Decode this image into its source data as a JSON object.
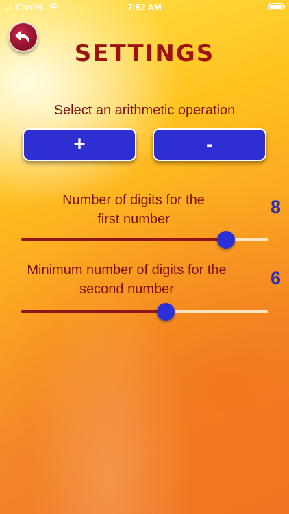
{
  "status_bar": {
    "carrier": "Carrier",
    "time": "7:52 AM"
  },
  "header": {
    "title": "SETTINGS",
    "back_icon": "back-arrow-icon"
  },
  "operation": {
    "label": "Select an arithmetic operation",
    "plus_label": "+",
    "minus_label": "-"
  },
  "first_number": {
    "label_line1": "Number of digits for the",
    "label_line2": "first number",
    "value": "8",
    "slider_fraction": 0.83
  },
  "second_number": {
    "label_line1": "Minimum number of digits for the",
    "label_line2": "second number",
    "value": "6",
    "slider_fraction": 0.585
  },
  "colors": {
    "title": "#9b1313",
    "label": "#7a1010",
    "button": "#2d2fd2",
    "value": "#2b2fb9",
    "slider_fill": "#8e1616",
    "slider_thumb": "#2b2fd6"
  }
}
